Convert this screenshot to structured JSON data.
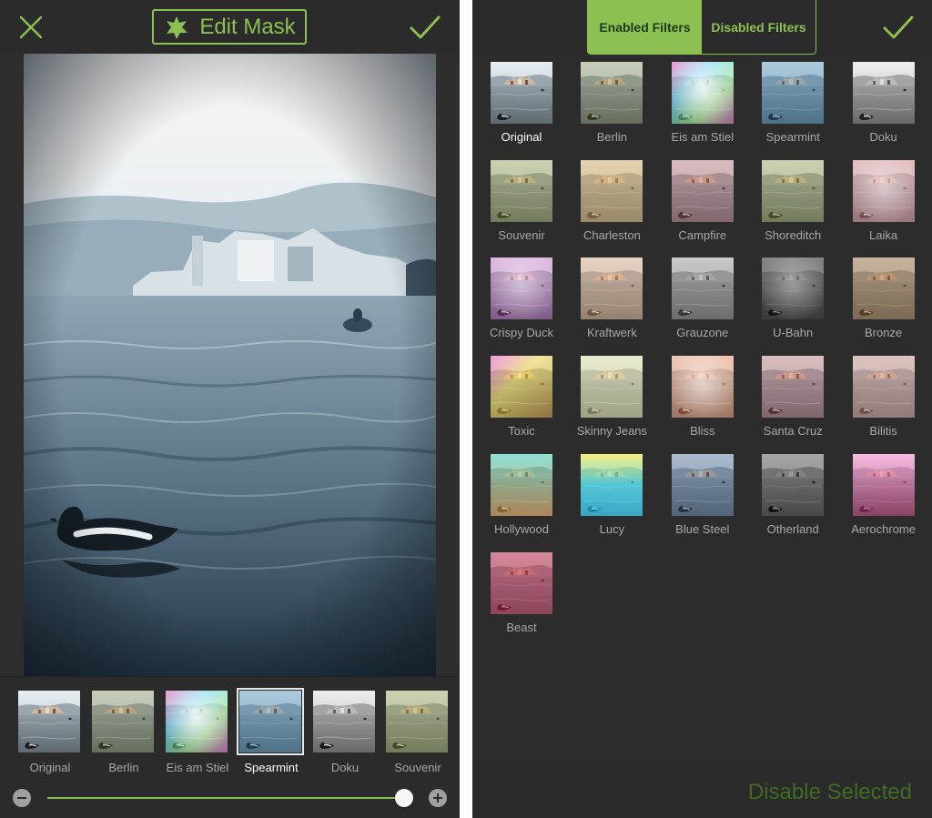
{
  "editor": {
    "edit_mask_label": "Edit Mask",
    "accent_color": "#8cc152",
    "filter_strip": [
      {
        "label": "Original",
        "selected": false,
        "tint": "none"
      },
      {
        "label": "Berlin",
        "selected": false,
        "tint": "warm-green"
      },
      {
        "label": "Eis am Stiel",
        "selected": false,
        "tint": "rainbow"
      },
      {
        "label": "Spearmint",
        "selected": true,
        "tint": "blue"
      },
      {
        "label": "Doku",
        "selected": false,
        "tint": "mono"
      },
      {
        "label": "Souvenir",
        "selected": false,
        "tint": "olive"
      }
    ],
    "intensity": 0.98
  },
  "filters_panel": {
    "tabs": [
      {
        "label": "Enabled Filters",
        "active": true
      },
      {
        "label": "Disabled Filters",
        "active": false
      }
    ],
    "filters": [
      {
        "label": "Original",
        "selected": true,
        "tint": "none"
      },
      {
        "label": "Berlin",
        "selected": false,
        "tint": "warm-green"
      },
      {
        "label": "Eis am Stiel",
        "selected": false,
        "tint": "rainbow"
      },
      {
        "label": "Spearmint",
        "selected": false,
        "tint": "blue"
      },
      {
        "label": "Doku",
        "selected": false,
        "tint": "mono"
      },
      {
        "label": "Souvenir",
        "selected": false,
        "tint": "olive"
      },
      {
        "label": "Charleston",
        "selected": false,
        "tint": "sepia"
      },
      {
        "label": "Campfire",
        "selected": false,
        "tint": "rose"
      },
      {
        "label": "Shoreditch",
        "selected": false,
        "tint": "olive"
      },
      {
        "label": "Laika",
        "selected": false,
        "tint": "pink"
      },
      {
        "label": "Crispy Duck",
        "selected": false,
        "tint": "magenta-light"
      },
      {
        "label": "Kraftwerk",
        "selected": false,
        "tint": "peach"
      },
      {
        "label": "Grauzone",
        "selected": false,
        "tint": "gray-green"
      },
      {
        "label": "U-Bahn",
        "selected": false,
        "tint": "dark-mono"
      },
      {
        "label": "Bronze",
        "selected": false,
        "tint": "bronze"
      },
      {
        "label": "Toxic",
        "selected": false,
        "tint": "toxic"
      },
      {
        "label": "Skinny Jeans",
        "selected": false,
        "tint": "cream"
      },
      {
        "label": "Bliss",
        "selected": false,
        "tint": "orange-flare"
      },
      {
        "label": "Santa Cruz",
        "selected": false,
        "tint": "rose"
      },
      {
        "label": "Bilitis",
        "selected": false,
        "tint": "faded-rose"
      },
      {
        "label": "Hollywood",
        "selected": false,
        "tint": "teal-orange"
      },
      {
        "label": "Lucy",
        "selected": false,
        "tint": "neon"
      },
      {
        "label": "Blue Steel",
        "selected": false,
        "tint": "steel"
      },
      {
        "label": "Otherland",
        "selected": false,
        "tint": "dark-gray"
      },
      {
        "label": "Aerochrome",
        "selected": false,
        "tint": "aero"
      },
      {
        "label": "Beast",
        "selected": false,
        "tint": "red"
      }
    ],
    "disable_label": "Disable Selected"
  }
}
